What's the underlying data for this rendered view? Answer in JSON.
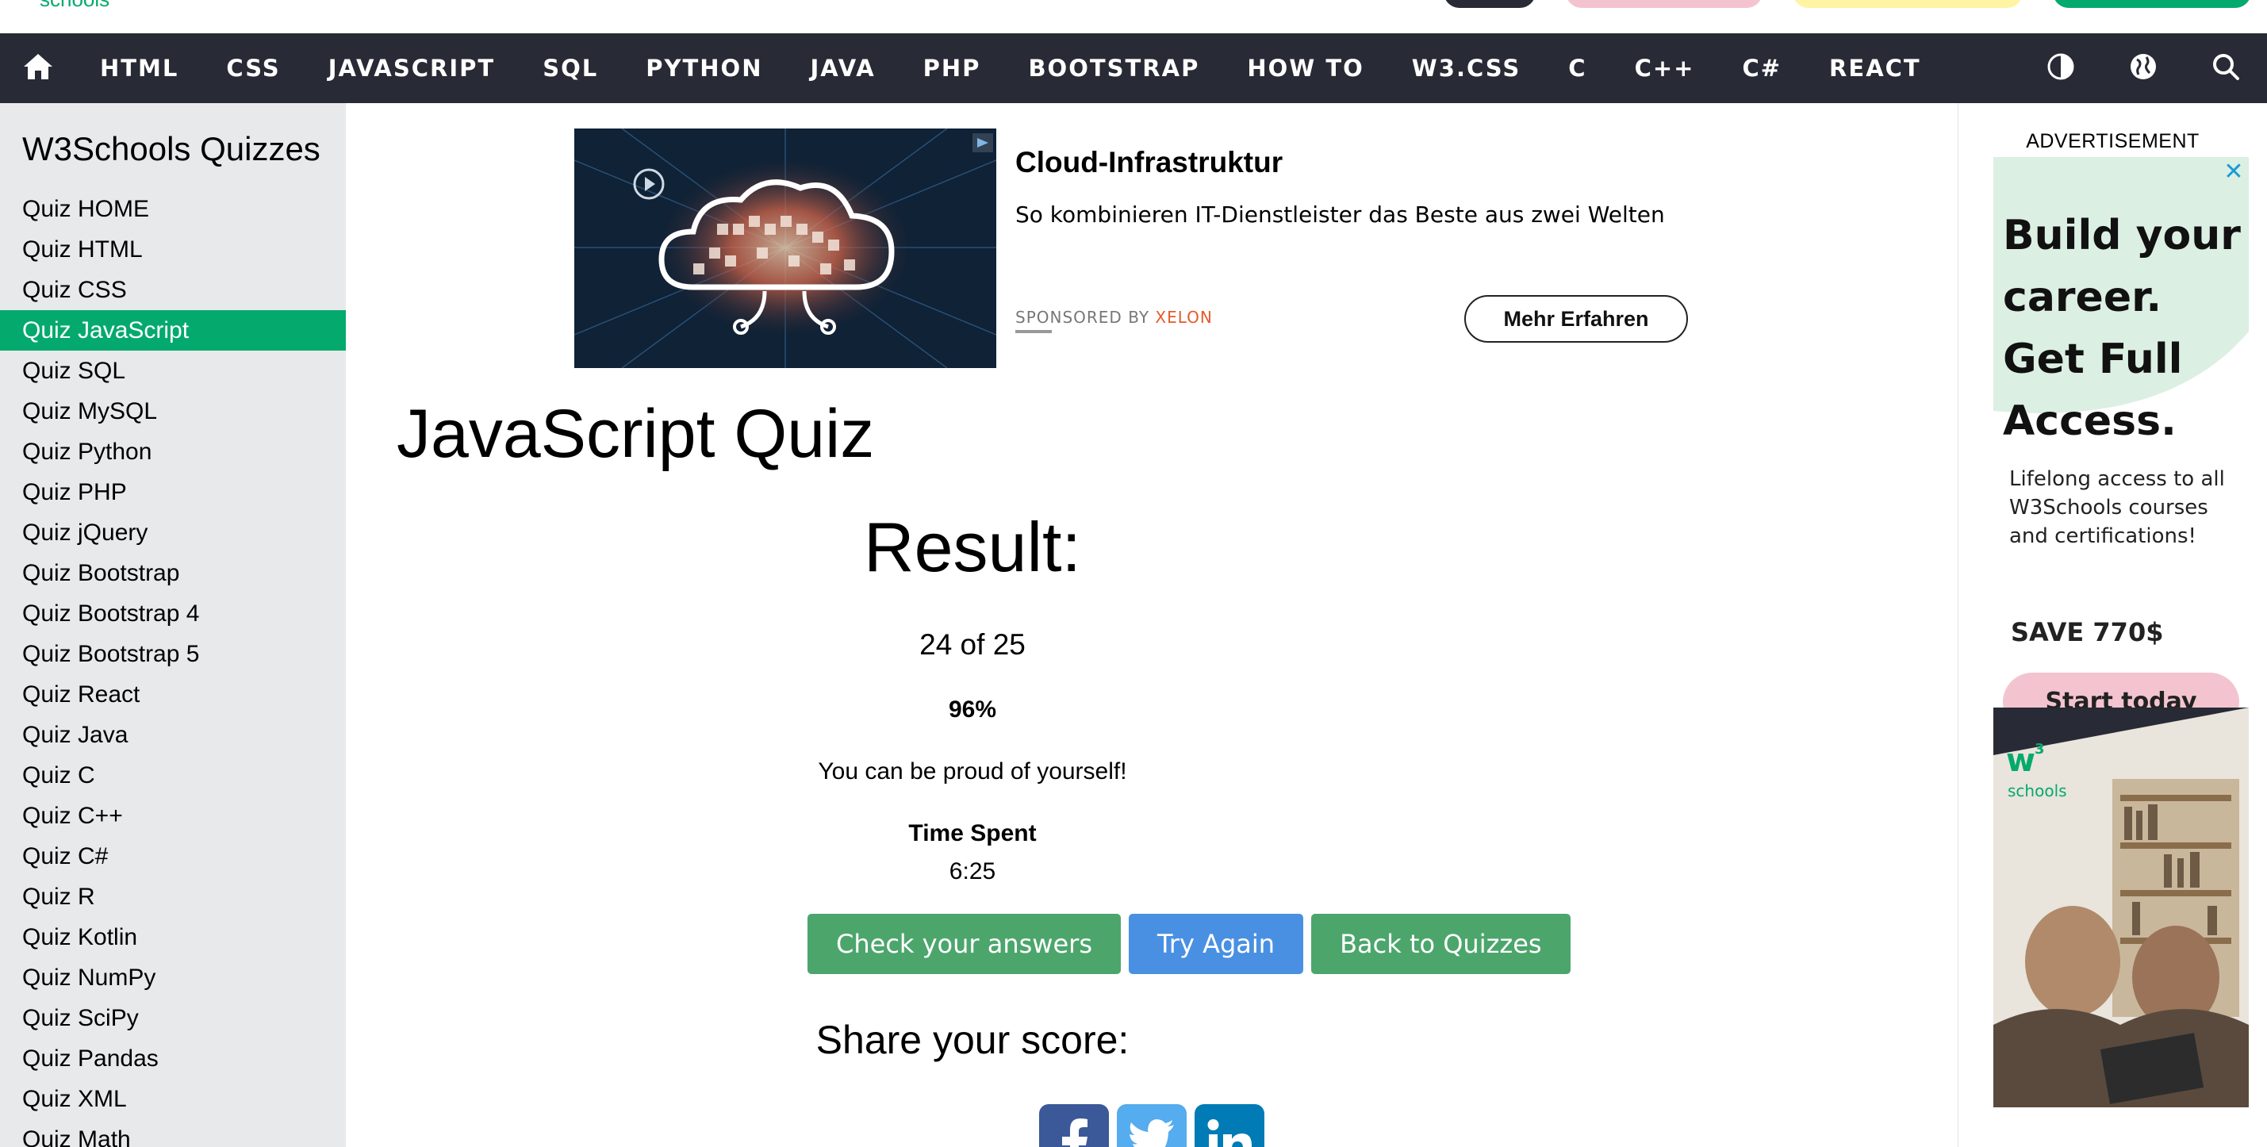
{
  "logo_partial": "schools",
  "nav": {
    "items": [
      "HTML",
      "CSS",
      "JAVASCRIPT",
      "SQL",
      "PYTHON",
      "JAVA",
      "PHP",
      "BOOTSTRAP",
      "HOW TO",
      "W3.CSS",
      "C",
      "C++",
      "C#",
      "REACT"
    ]
  },
  "sidebar": {
    "title": "W3Schools Quizzes",
    "items": [
      {
        "label": "Quiz HOME",
        "active": false
      },
      {
        "label": "Quiz HTML",
        "active": false
      },
      {
        "label": "Quiz CSS",
        "active": false
      },
      {
        "label": "Quiz JavaScript",
        "active": true
      },
      {
        "label": "Quiz SQL",
        "active": false
      },
      {
        "label": "Quiz MySQL",
        "active": false
      },
      {
        "label": "Quiz Python",
        "active": false
      },
      {
        "label": "Quiz PHP",
        "active": false
      },
      {
        "label": "Quiz jQuery",
        "active": false
      },
      {
        "label": "Quiz Bootstrap",
        "active": false
      },
      {
        "label": "Quiz Bootstrap 4",
        "active": false
      },
      {
        "label": "Quiz Bootstrap 5",
        "active": false
      },
      {
        "label": "Quiz React",
        "active": false
      },
      {
        "label": "Quiz Java",
        "active": false
      },
      {
        "label": "Quiz C",
        "active": false
      },
      {
        "label": "Quiz C++",
        "active": false
      },
      {
        "label": "Quiz C#",
        "active": false
      },
      {
        "label": "Quiz R",
        "active": false
      },
      {
        "label": "Quiz Kotlin",
        "active": false
      },
      {
        "label": "Quiz NumPy",
        "active": false
      },
      {
        "label": "Quiz SciPy",
        "active": false
      },
      {
        "label": "Quiz Pandas",
        "active": false
      },
      {
        "label": "Quiz XML",
        "active": false
      },
      {
        "label": "Quiz Math",
        "active": false
      }
    ]
  },
  "top_ad": {
    "title": "Cloud-Infrastruktur",
    "description": "So kombinieren IT-Dienstleister das Beste aus zwei Welten",
    "sponsored_prefix": "SPONSORED BY",
    "sponsor": "XELON",
    "cta": "Mehr Erfahren"
  },
  "main": {
    "title": "JavaScript Quiz",
    "result_heading": "Result:",
    "score_text": "24 of 25",
    "percent": "96%",
    "praise": "You can be proud of yourself!",
    "time_label": "Time Spent",
    "time_value": "6:25",
    "buttons": {
      "check": "Check your answers",
      "try_again": "Try Again",
      "back": "Back to Quizzes"
    },
    "share_heading": "Share your score:"
  },
  "right_ad": {
    "label": "ADVERTISEMENT",
    "headline": "Build your career. Get Full Access.",
    "text": "Lifelong access to all W3Schools courses and certifications!",
    "save": "SAVE 770$",
    "cta": "Start today"
  },
  "colors": {
    "navbar": "#282A35",
    "accent_green": "#04AA6D",
    "button_green": "#4CA66C",
    "button_blue": "#4A90E2",
    "sidebar_bg": "#E7E9EB",
    "facebook": "#3B5998",
    "twitter": "#55ACEE",
    "linkedin": "#007BB5"
  },
  "icons": {
    "nav_home": "home-icon",
    "nav_theme": "contrast-icon",
    "nav_language": "globe-icon",
    "nav_search": "search-icon",
    "share": [
      "facebook-icon",
      "twitter-icon",
      "linkedin-icon"
    ]
  }
}
